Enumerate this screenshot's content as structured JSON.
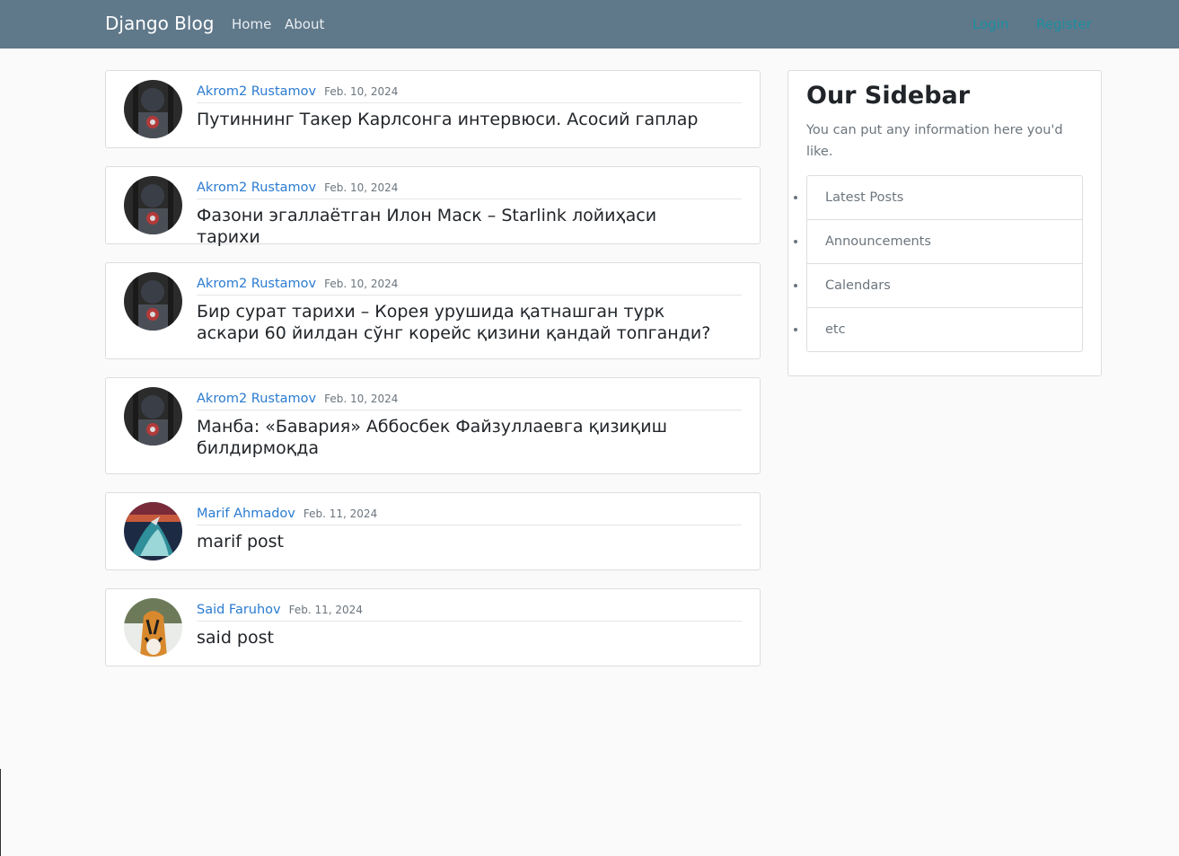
{
  "navbar": {
    "brand": "Django Blog",
    "links": [
      "Home",
      "About"
    ],
    "right_links": [
      "Login",
      "Register"
    ],
    "background": "#5f788a"
  },
  "posts": [
    {
      "author": "Akrom2 Rustamov",
      "date": "Feb. 10, 2024",
      "title": "Путиннинг Такер Карлсонга интервюси. Асосий гаплар",
      "avatar": "captain-america-avatar"
    },
    {
      "author": "Akrom2 Rustamov",
      "date": "Feb. 10, 2024",
      "title": "Фазони эгаллаётган Илон Маск – Starlink лойиҳаси тарихи",
      "avatar": "captain-america-avatar"
    },
    {
      "author": "Akrom2 Rustamov",
      "date": "Feb. 10, 2024",
      "title": "Бир сурат тарихи – Корея урушида қатнашган турк аскари 60 йилдан сўнг корейс қизини қандай топганди?",
      "avatar": "captain-america-avatar"
    },
    {
      "author": "Akrom2 Rustamov",
      "date": "Feb. 10, 2024",
      "title": "Манба: «Бавария» Аббосбек Файзуллаевга қизиқиш билдирмоқда",
      "avatar": "captain-america-avatar"
    },
    {
      "author": "Marif Ahmadov",
      "date": "Feb. 11, 2024",
      "title": "marif post",
      "avatar": "dragon-avatar"
    },
    {
      "author": "Said Faruhov",
      "date": "Feb. 11, 2024",
      "title": "said post",
      "avatar": "tiger-avatar"
    }
  ],
  "sidebar": {
    "title": "Our Sidebar",
    "text": "You can put any information here you'd like.",
    "items": [
      "Latest Posts",
      "Announcements",
      "Calendars",
      "etc"
    ]
  },
  "colors": {
    "link": "#2a7bd0",
    "nav_right_link": "#1a8fa0",
    "page_background": "#fafafa"
  }
}
